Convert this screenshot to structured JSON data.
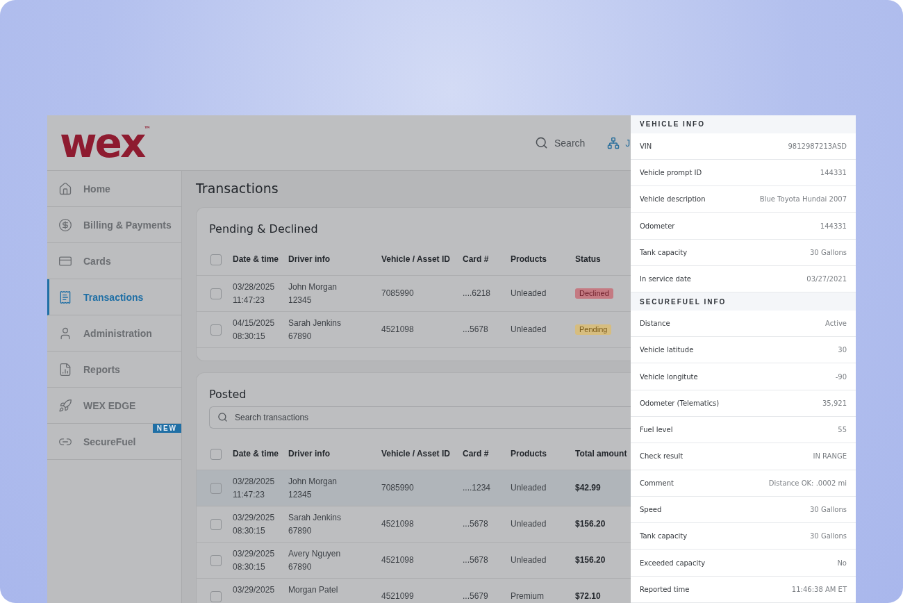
{
  "logo": {
    "text": "wex",
    "mark": "™"
  },
  "header": {
    "search_label": "Search",
    "account_label": "J"
  },
  "sidebar": {
    "items": [
      {
        "label": "Home",
        "selected": false
      },
      {
        "label": "Billing & Payments",
        "selected": false
      },
      {
        "label": "Cards",
        "selected": false
      },
      {
        "label": "Transactions",
        "selected": true
      },
      {
        "label": "Administration",
        "selected": false
      },
      {
        "label": "Reports",
        "selected": false
      },
      {
        "label": "WEX EDGE",
        "selected": false
      },
      {
        "label": "SecureFuel",
        "selected": false,
        "badge": "NEW"
      }
    ]
  },
  "page_title": "Transactions",
  "pending_table": {
    "title": "Pending & Declined",
    "header_checked": false,
    "columns": [
      "Date & time",
      "Driver info",
      "Vehicle / Asset ID",
      "Card #",
      "Products",
      "Status"
    ],
    "rows": [
      {
        "checked": false,
        "selected": false,
        "date": "03/28/2025",
        "time": "11:47:23",
        "driver": "John Morgan",
        "driver_id": "12345",
        "vehicle": "7085990",
        "card": "....6218",
        "product": "Unleaded",
        "status": "Declined",
        "kind": "declined"
      },
      {
        "checked": false,
        "selected": false,
        "date": "04/15/2025",
        "time": "08:30:15",
        "driver": "Sarah Jenkins",
        "driver_id": "67890",
        "vehicle": "4521098",
        "card": "...5678",
        "product": "Unleaded",
        "status": "Pending",
        "kind": "pending"
      }
    ]
  },
  "posted_table": {
    "title": "Posted",
    "search": {
      "placeholder": "Search transactions"
    },
    "header_checked": false,
    "columns": [
      "Date & time",
      "Driver info",
      "Vehicle / Asset ID",
      "Card #",
      "Products",
      "Total amount"
    ],
    "rows": [
      {
        "checked": false,
        "selected": true,
        "date": "03/28/2025",
        "time": "11:47:23",
        "driver": "John Morgan",
        "driver_id": "12345",
        "vehicle": "7085990",
        "card": "....1234",
        "product": "Unleaded",
        "amount": "$42.99"
      },
      {
        "checked": false,
        "selected": false,
        "date": "03/29/2025",
        "time": "08:30:15",
        "driver": "Sarah Jenkins",
        "driver_id": "67890",
        "vehicle": "4521098",
        "card": "...5678",
        "product": "Unleaded",
        "amount": "$156.20"
      },
      {
        "checked": false,
        "selected": false,
        "date": "03/29/2025",
        "time": "08:30:15",
        "driver": "Avery Nguyen",
        "driver_id": "67890",
        "vehicle": "4521098",
        "card": "...5678",
        "product": "Unleaded",
        "amount": "$156.20"
      },
      {
        "checked": false,
        "selected": false,
        "date": "03/29/2025",
        "driver": "Morgan Patel",
        "vehicle": "4521099",
        "card": "...5679",
        "product": "Premium",
        "amount": "$72.10"
      }
    ]
  },
  "details_panel": {
    "sections": [
      {
        "title": "VEHICLE INFO",
        "rows": [
          {
            "label": "VIN",
            "value": "9812987213ASD"
          },
          {
            "label": "Vehicle prompt ID",
            "value": "144331"
          },
          {
            "label": "Vehicle description",
            "value": "Blue Toyota Hundai 2007"
          },
          {
            "label": "Odometer",
            "value": "144331"
          },
          {
            "label": "Tank capacity",
            "value": "30 Gallons"
          },
          {
            "label": "In service date",
            "value": "03/27/2021"
          }
        ]
      },
      {
        "title": "SECUREFUEL INFO",
        "rows": [
          {
            "label": "Distance",
            "value": "Active"
          },
          {
            "label": "Vehicle latitude",
            "value": "30"
          },
          {
            "label": "Vehicle longitute",
            "value": "-90"
          },
          {
            "label": "Odometer (Telematics)",
            "value": "35,921"
          },
          {
            "label": "Fuel level",
            "value": "55"
          },
          {
            "label": "Check result",
            "value": "IN RANGE"
          },
          {
            "label": "Comment",
            "value": "Distance OK: .0002 mi"
          },
          {
            "label": "Speed",
            "value": "30 Gallons"
          },
          {
            "label": "Tank capacity",
            "value": "30 Gallons"
          },
          {
            "label": "Exceeded capacity",
            "value": "No"
          },
          {
            "label": "Reported time",
            "value": "11:46:38 AM ET"
          }
        ]
      }
    ]
  }
}
